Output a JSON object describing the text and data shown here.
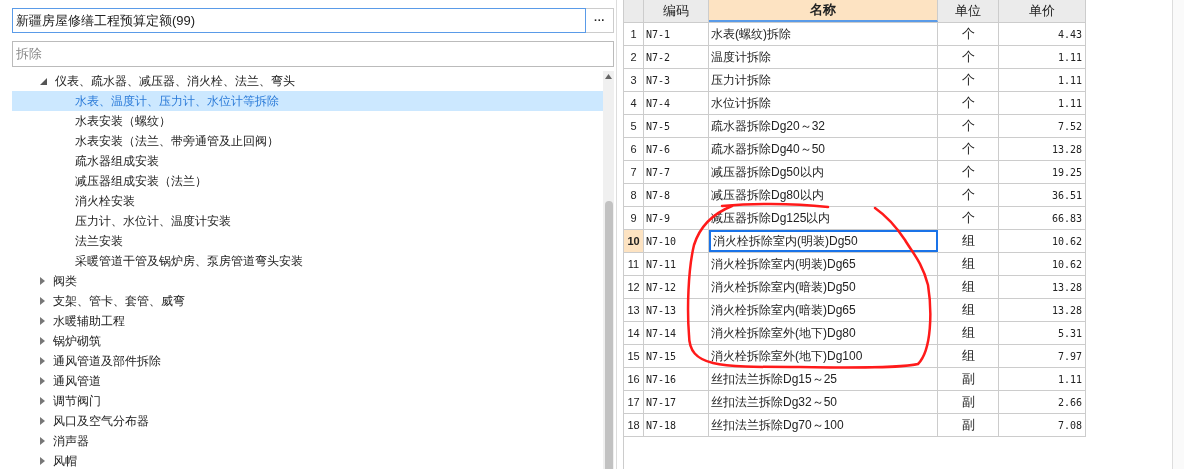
{
  "library": {
    "value": "新疆房屋修缮工程预算定额(99)",
    "button": "···"
  },
  "search": {
    "value": "拆除"
  },
  "tree": [
    {
      "label": "仪表、疏水器、减压器、消火栓、法兰、弯头",
      "expanded": true,
      "selected": false,
      "children": [
        {
          "label": "水表、温度计、压力计、水位计等拆除",
          "selected": true
        },
        {
          "label": "水表安装（螺纹）",
          "selected": false
        },
        {
          "label": "水表安装（法兰、带旁通管及止回阀）",
          "selected": false
        },
        {
          "label": "疏水器组成安装",
          "selected": false
        },
        {
          "label": "减压器组成安装（法兰）",
          "selected": false
        },
        {
          "label": "消火栓安装",
          "selected": false
        },
        {
          "label": "压力计、水位计、温度计安装",
          "selected": false
        },
        {
          "label": "法兰安装",
          "selected": false
        },
        {
          "label": "采暖管道干管及锅炉房、泵房管道弯头安装",
          "selected": false
        }
      ]
    },
    {
      "label": "阀类",
      "expanded": false,
      "selected": false
    },
    {
      "label": "支架、管卡、套管、威弯",
      "expanded": false,
      "selected": false
    },
    {
      "label": "水暖辅助工程",
      "expanded": false,
      "selected": false
    },
    {
      "label": "锅炉砌筑",
      "expanded": false,
      "selected": false
    },
    {
      "label": "通风管道及部件拆除",
      "expanded": false,
      "selected": false
    },
    {
      "label": "通风管道",
      "expanded": false,
      "selected": false
    },
    {
      "label": "调节阀门",
      "expanded": false,
      "selected": false
    },
    {
      "label": "风口及空气分布器",
      "expanded": false,
      "selected": false
    },
    {
      "label": "消声器",
      "expanded": false,
      "selected": false
    },
    {
      "label": "风帽",
      "expanded": false,
      "selected": false
    }
  ],
  "table": {
    "columns": [
      {
        "label": "编码",
        "selected": false
      },
      {
        "label": "名称",
        "selected": true
      },
      {
        "label": "单位",
        "selected": false
      },
      {
        "label": "单价",
        "selected": false
      }
    ],
    "rows": [
      {
        "index": "1",
        "code": "N7-1",
        "name": "水表(螺纹)拆除",
        "unit": "个",
        "price": "4.43",
        "selected": false
      },
      {
        "index": "2",
        "code": "N7-2",
        "name": "温度计拆除",
        "unit": "个",
        "price": "1.11",
        "selected": false
      },
      {
        "index": "3",
        "code": "N7-3",
        "name": "压力计拆除",
        "unit": "个",
        "price": "1.11",
        "selected": false
      },
      {
        "index": "4",
        "code": "N7-4",
        "name": "水位计拆除",
        "unit": "个",
        "price": "1.11",
        "selected": false
      },
      {
        "index": "5",
        "code": "N7-5",
        "name": "疏水器拆除Dg20～32",
        "unit": "个",
        "price": "7.52",
        "selected": false
      },
      {
        "index": "6",
        "code": "N7-6",
        "name": "疏水器拆除Dg40～50",
        "unit": "个",
        "price": "13.28",
        "selected": false
      },
      {
        "index": "7",
        "code": "N7-7",
        "name": "减压器拆除Dg50以内",
        "unit": "个",
        "price": "19.25",
        "selected": false
      },
      {
        "index": "8",
        "code": "N7-8",
        "name": "减压器拆除Dg80以内",
        "unit": "个",
        "price": "36.51",
        "selected": false
      },
      {
        "index": "9",
        "code": "N7-9",
        "name": "减压器拆除Dg125以内",
        "unit": "个",
        "price": "66.83",
        "selected": false
      },
      {
        "index": "10",
        "code": "N7-10",
        "name": "消火栓拆除室内(明装)Dg50",
        "unit": "组",
        "price": "10.62",
        "selected": true
      },
      {
        "index": "11",
        "code": "N7-11",
        "name": "消火栓拆除室内(明装)Dg65",
        "unit": "组",
        "price": "10.62",
        "selected": false
      },
      {
        "index": "12",
        "code": "N7-12",
        "name": "消火栓拆除室内(暗装)Dg50",
        "unit": "组",
        "price": "13.28",
        "selected": false
      },
      {
        "index": "13",
        "code": "N7-13",
        "name": "消火栓拆除室内(暗装)Dg65",
        "unit": "组",
        "price": "13.28",
        "selected": false
      },
      {
        "index": "14",
        "code": "N7-14",
        "name": "消火栓拆除室外(地下)Dg80",
        "unit": "组",
        "price": "5.31",
        "selected": false
      },
      {
        "index": "15",
        "code": "N7-15",
        "name": "消火栓拆除室外(地下)Dg100",
        "unit": "组",
        "price": "7.97",
        "selected": false
      },
      {
        "index": "16",
        "code": "N7-16",
        "name": "丝扣法兰拆除Dg15～25",
        "unit": "副",
        "price": "1.11",
        "selected": false
      },
      {
        "index": "17",
        "code": "N7-17",
        "name": "丝扣法兰拆除Dg32～50",
        "unit": "副",
        "price": "2.66",
        "selected": false
      },
      {
        "index": "18",
        "code": "N7-18",
        "name": "丝扣法兰拆除Dg70～100",
        "unit": "副",
        "price": "7.08",
        "selected": false
      }
    ]
  }
}
